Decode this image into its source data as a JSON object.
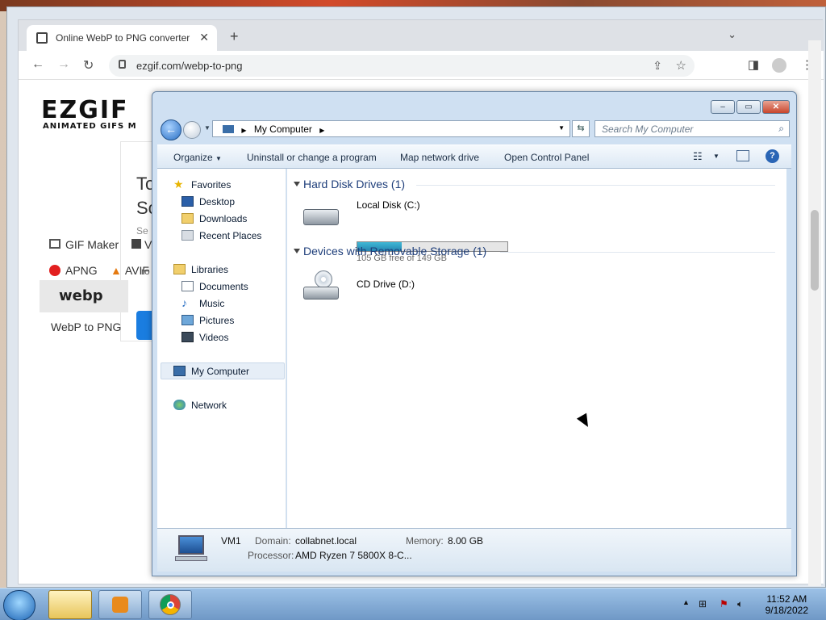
{
  "browser": {
    "tab_title": "Online WebP to PNG converter",
    "url": "ezgif.com/webp-to-png",
    "icons": [
      "back-icon",
      "forward-icon",
      "reload-icon",
      "lock-icon",
      "share-icon",
      "star-icon",
      "sidepanel-icon",
      "profile-icon",
      "menu-icon"
    ]
  },
  "page": {
    "logo": "EZGIF",
    "logo_sub": "ANIMATED GIFS M",
    "heading_a": "To",
    "heading_b": "Sc",
    "small_a": "Se",
    "tools": {
      "gif_maker": "GIF Maker",
      "gif_frag": "V",
      "apng": "APNG",
      "avif": "AVIF",
      "avif_frag": "ro",
      "webp_logo": "webp",
      "webp_to_png": "WebP to PNG"
    }
  },
  "explorer": {
    "address": "My Computer",
    "search_placeholder": "Search My Computer",
    "commands": {
      "organize": "Organize",
      "uninstall": "Uninstall or change a program",
      "map_drive": "Map network drive",
      "control_panel": "Open Control Panel"
    },
    "nav": {
      "favorites": "Favorites",
      "desktop": "Desktop",
      "downloads": "Downloads",
      "recent": "Recent Places",
      "libraries": "Libraries",
      "documents": "Documents",
      "music": "Music",
      "pictures": "Pictures",
      "videos": "Videos",
      "computer": "My Computer",
      "network": "Network"
    },
    "groups": {
      "hdd": "Hard Disk Drives (1)",
      "removable": "Devices with Removable Storage (1)"
    },
    "drives": {
      "c_name": "Local Disk (C:)",
      "c_free": "105 GB free of 149 GB",
      "c_used_fraction": 0.295,
      "d_name": "CD Drive (D:)"
    },
    "details": {
      "name": "VM1",
      "domain_label": "Domain:",
      "domain": "collabnet.local",
      "memory_label": "Memory:",
      "memory": "8.00 GB",
      "processor_label": "Processor:",
      "processor": "AMD Ryzen 7 5800X 8-C..."
    }
  },
  "taskbar": {
    "time": "11:52 AM",
    "date": "9/18/2022"
  }
}
